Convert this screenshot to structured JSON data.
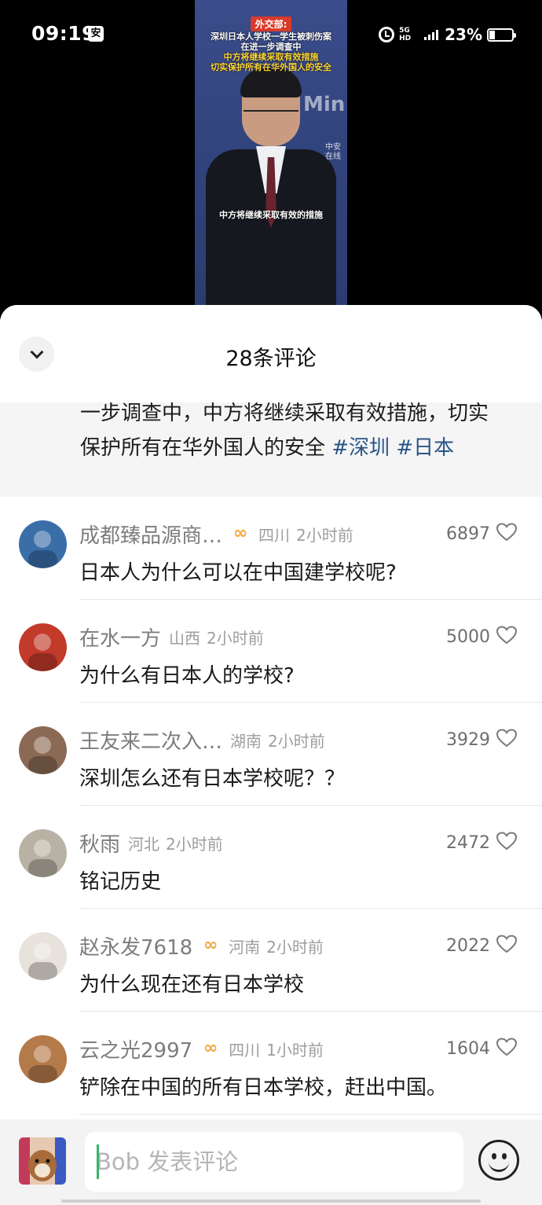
{
  "status_bar": {
    "time": "09:19",
    "app_icon_label": "安",
    "network": "5G HD",
    "battery": "23%"
  },
  "video": {
    "tag": "外交部:",
    "headline_lines": [
      "深圳日本人学校一学生被刺伤案",
      "在进一步调查中"
    ],
    "highlight_lines": [
      "中方将继续采取有效措施",
      "切实保护所有在华外国人的安全"
    ],
    "background_text": "Min",
    "badge": "中安在线",
    "caption": "中方将继续采取有效的措施"
  },
  "sheet": {
    "title": "28条评论",
    "post_text_line1": "一步调查中，中方将继续采取有效措施，切实",
    "post_text_line2": "保护所有在华外国人的安全 ",
    "hashtags": [
      "#深圳",
      "#日本"
    ]
  },
  "comments": [
    {
      "user": "成都臻品源商…",
      "vip": true,
      "location": "四川",
      "time": "2小时前",
      "likes": "6897",
      "text": "日本人为什么可以在中国建学校呢?",
      "avatar_color": "#3a6ea8"
    },
    {
      "user": "在水一方",
      "vip": false,
      "location": "山西",
      "time": "2小时前",
      "likes": "5000",
      "text": "为什么有日本人的学校?",
      "avatar_color": "#c23a2a"
    },
    {
      "user": "王友来二次入…",
      "vip": false,
      "location": "湖南",
      "time": "2小时前",
      "likes": "3929",
      "text": "深圳怎么还有日本学校呢？？",
      "avatar_color": "#8a6a55"
    },
    {
      "user": "秋雨",
      "vip": false,
      "location": "河北",
      "time": "2小时前",
      "likes": "2472",
      "text": "铭记历史",
      "avatar_color": "#b8b2a4"
    },
    {
      "user": "赵永发7618",
      "vip": true,
      "location": "河南",
      "time": "2小时前",
      "likes": "2022",
      "text": "为什么现在还有日本学校",
      "avatar_color": "#e8e2dc"
    },
    {
      "user": "云之光2997",
      "vip": true,
      "location": "四川",
      "time": "1小时前",
      "likes": "1604",
      "text": "铲除在中国的所有日本学校，赶出中国。",
      "avatar_color": "#b57a4a"
    }
  ],
  "input_bar": {
    "placeholder": "Bob 发表评论"
  }
}
